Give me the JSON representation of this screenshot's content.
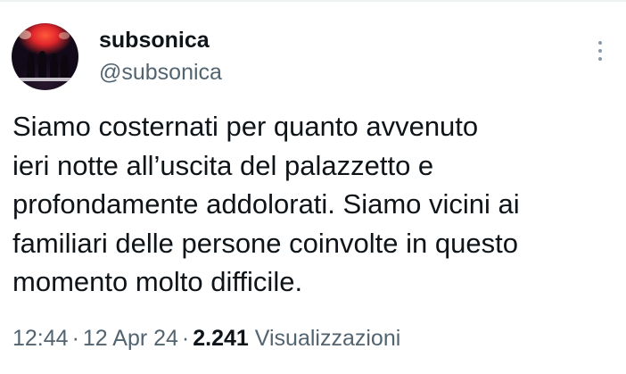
{
  "tweet": {
    "author": {
      "display_name": "subsonica",
      "handle": "@subsonica"
    },
    "more_icon": "more-vertical-icon",
    "text_lines": [
      "Siamo costernati per quanto avvenuto",
      "ieri notte all’uscita del palazzetto e",
      "profondamente addolorati. Siamo vicini ai",
      "familiari delle persone coinvolte in questo",
      "momento molto difficile."
    ],
    "meta": {
      "time": "12:44",
      "separator": "·",
      "date": "12 Apr 24",
      "views_count": "2.241",
      "views_label": "Visualizzazioni"
    }
  },
  "colors": {
    "text_primary": "#0f1419",
    "text_secondary": "#536471",
    "icon_gray": "#8b98a5"
  }
}
